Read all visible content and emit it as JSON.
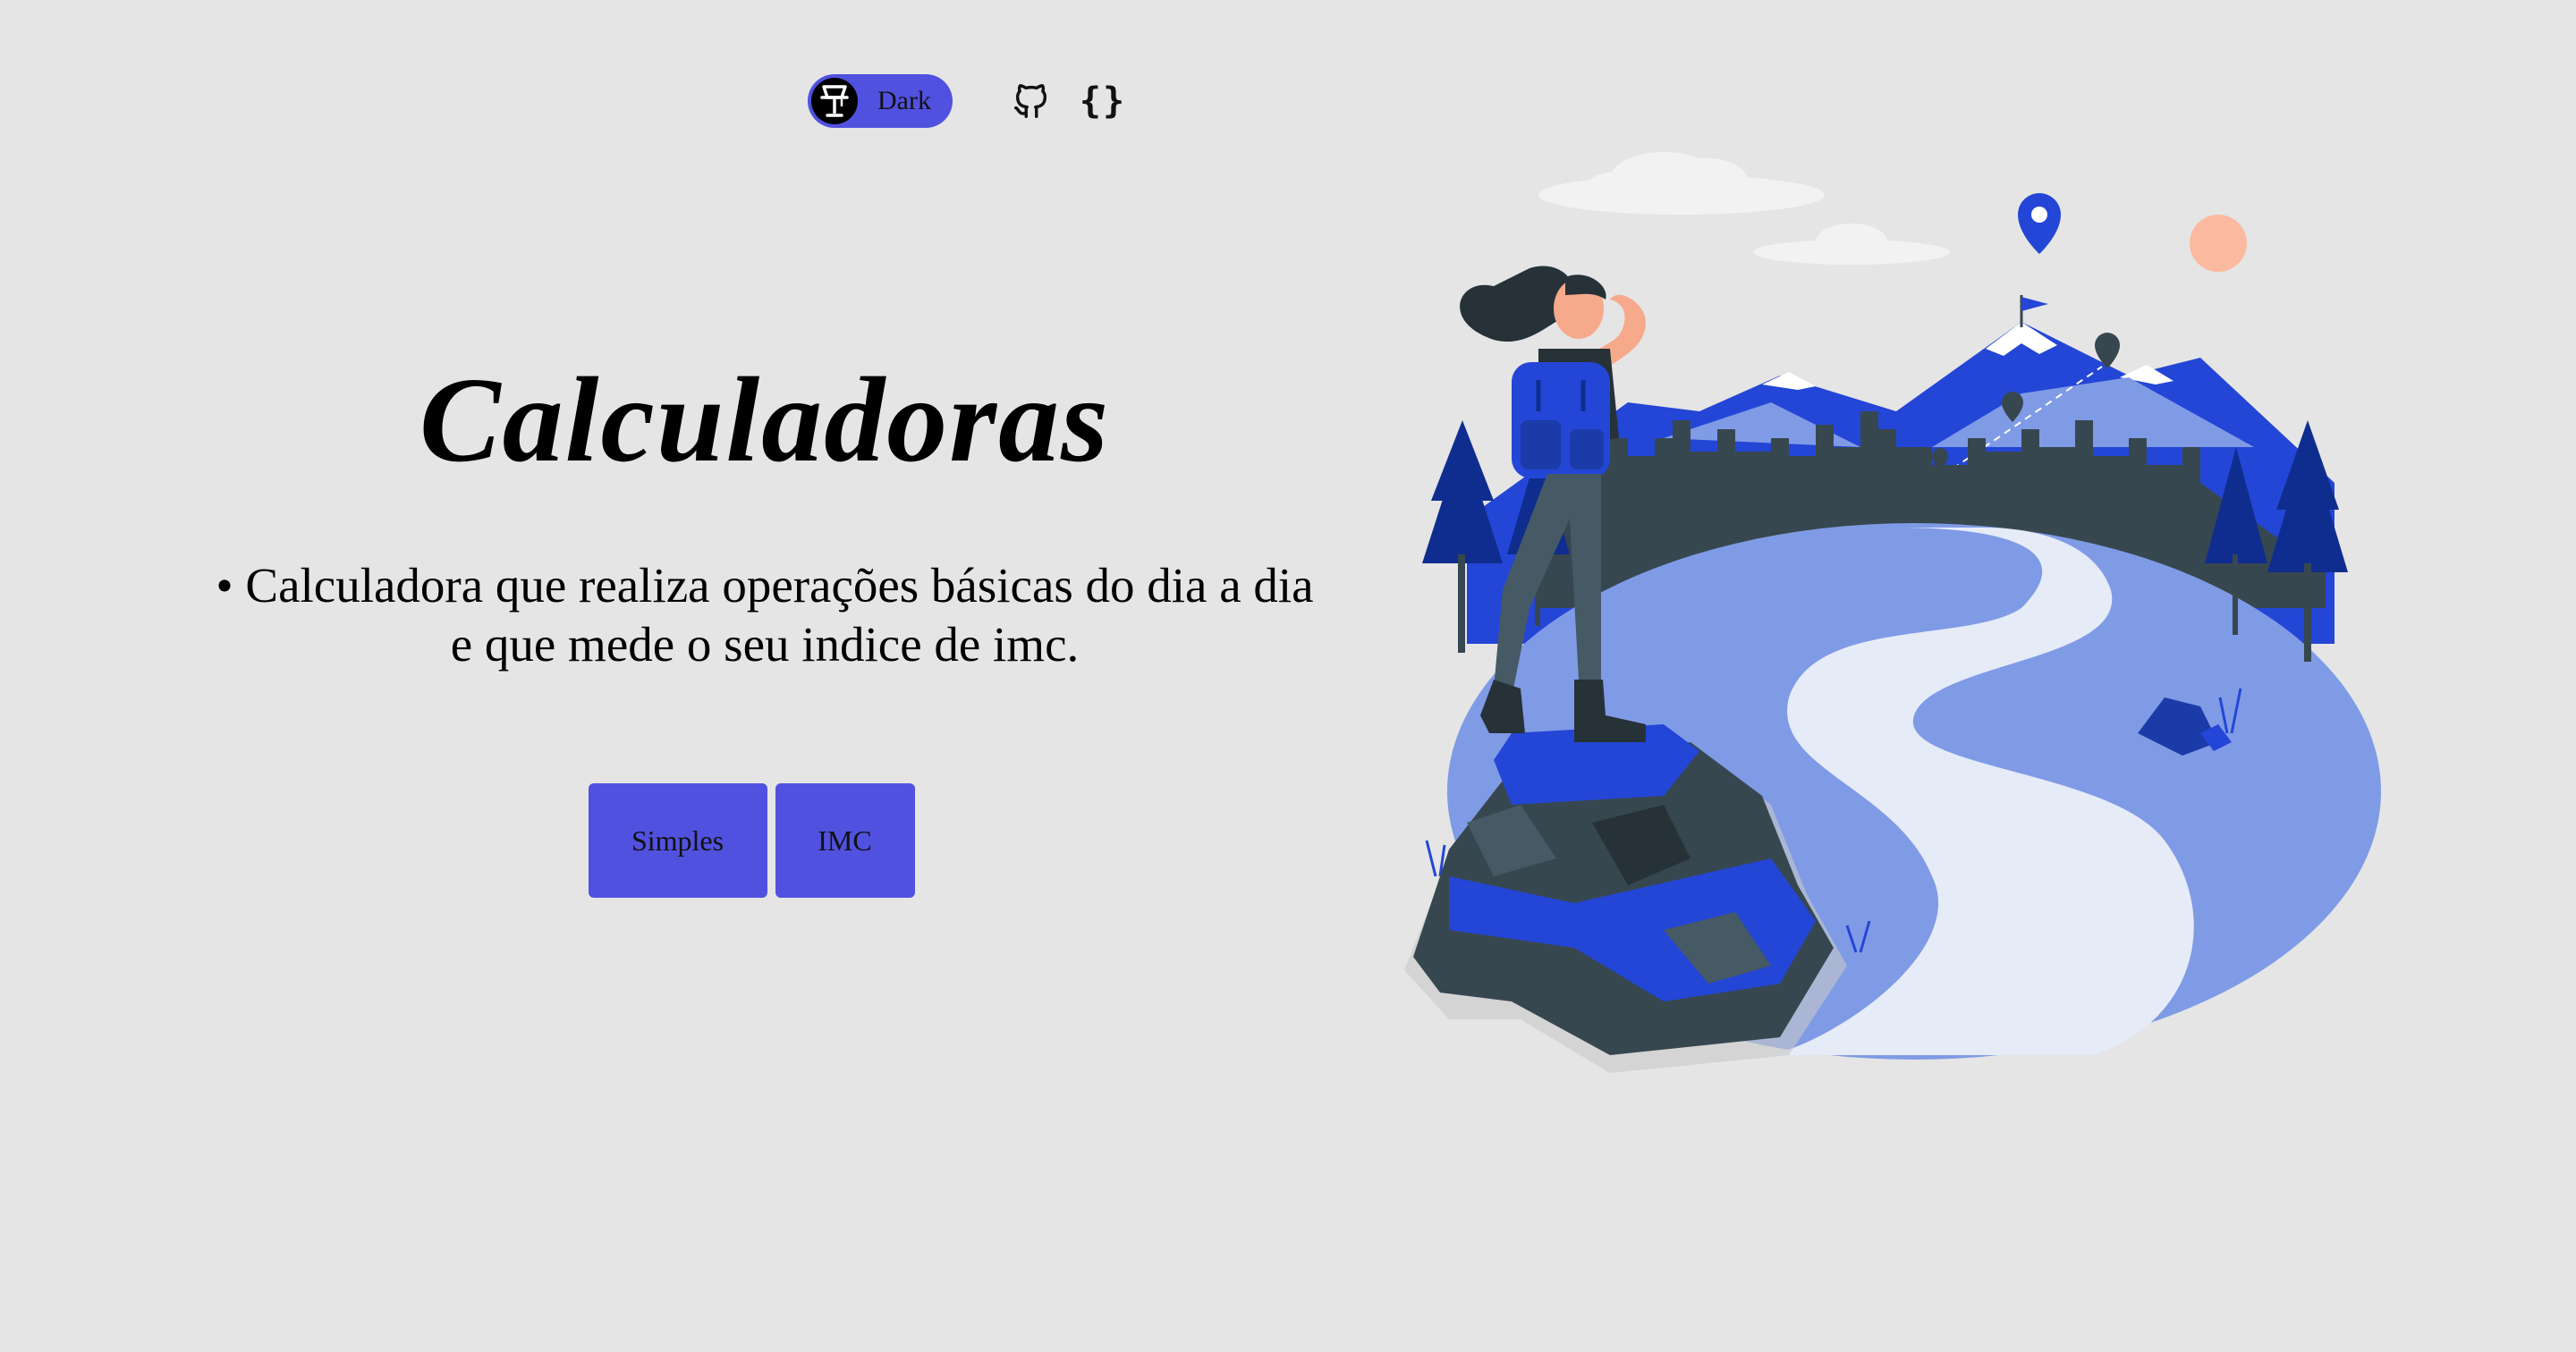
{
  "nav": {
    "theme_toggle_label": "Dark",
    "github_icon": "github-icon",
    "code_icon_text": "{}"
  },
  "hero": {
    "title": "Calculadoras",
    "description_line1": "• Calculadora que realiza operações básicas do dia a dia",
    "description_line2": "e que mede o seu indice de imc."
  },
  "buttons": {
    "simples_label": "Simples",
    "imc_label": "IMC"
  },
  "colors": {
    "background": "#e5e5e5",
    "accent": "#5151e0",
    "illustration_primary": "#2446d6",
    "illustration_light": "#7f9be6",
    "illustration_path": "#e6ebf8",
    "illustration_dark": "#37474f"
  }
}
